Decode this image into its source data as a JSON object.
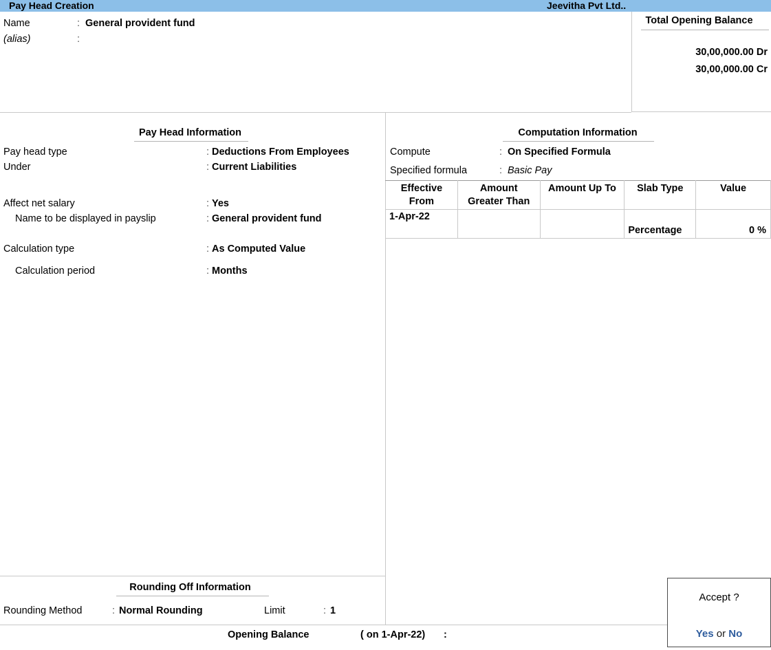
{
  "titlebar": {
    "screen_title": "Pay Head  Creation",
    "company_name": "Jeevitha Pvt Ltd.."
  },
  "identity": {
    "name_label": "Name",
    "name_value": "General provident fund",
    "alias_label": "(alias)",
    "alias_value": "",
    "colon": ":"
  },
  "total_opening_balance": {
    "title": "Total Opening Balance",
    "debit": "30,00,000.00 Dr",
    "credit": "30,00,000.00 Cr"
  },
  "pay_head_information": {
    "heading": "Pay Head Information",
    "fields": [
      {
        "label": "Pay head type",
        "colon": ":",
        "value": "Deductions From Employees"
      },
      {
        "label": "Under",
        "colon": ":",
        "value": "Current Liabilities"
      },
      {
        "label": "Affect net salary",
        "colon": ":",
        "value": "Yes"
      },
      {
        "label": "Name to be displayed in payslip",
        "colon": ":",
        "value": "General provident fund"
      },
      {
        "label": "Calculation type",
        "colon": ":",
        "value": "As Computed Value"
      },
      {
        "label": "Calculation period",
        "colon": ":",
        "value": "Months"
      }
    ]
  },
  "computation_information": {
    "heading": "Computation Information",
    "fields": [
      {
        "label": "Compute",
        "colon": ":",
        "value": "On Specified Formula"
      },
      {
        "label": "Specified formula",
        "colon": ":",
        "value": "Basic Pay"
      }
    ],
    "slab_table": {
      "columns": [
        "Effective From",
        "Amount Greater Than",
        "Amount Up To",
        "Slab Type",
        "Value"
      ],
      "columns_lines": [
        [
          "Effective",
          "From"
        ],
        [
          "Amount",
          "Greater Than"
        ],
        [
          "Amount Up To",
          ""
        ],
        [
          "Slab Type",
          ""
        ],
        [
          "Value",
          ""
        ]
      ],
      "rows": [
        {
          "effective_from": "1-Apr-22",
          "amount_greater_than": "",
          "amount_up_to": "",
          "slab_type": "Percentage",
          "value": "0 %"
        }
      ]
    }
  },
  "rounding_off_information": {
    "heading": "Rounding Off Information",
    "method_label": "Rounding Method",
    "method_colon": ":",
    "method_value": "Normal Rounding",
    "limit_label": "Limit",
    "limit_colon": ":",
    "limit_value": "1"
  },
  "status_bar": {
    "opening_balance_label": "Opening Balance",
    "opening_balance_date": "( on 1-Apr-22)",
    "opening_balance_colon": ":"
  },
  "accept_dialog": {
    "prompt": "Accept ?",
    "yes_label": "Yes",
    "or_label": "or",
    "no_label": "No"
  },
  "colors": {
    "titlebar_blue": "#8cbfe8",
    "link_blue": "#2f5d9e",
    "rule_gray": "#c8c8c8"
  }
}
